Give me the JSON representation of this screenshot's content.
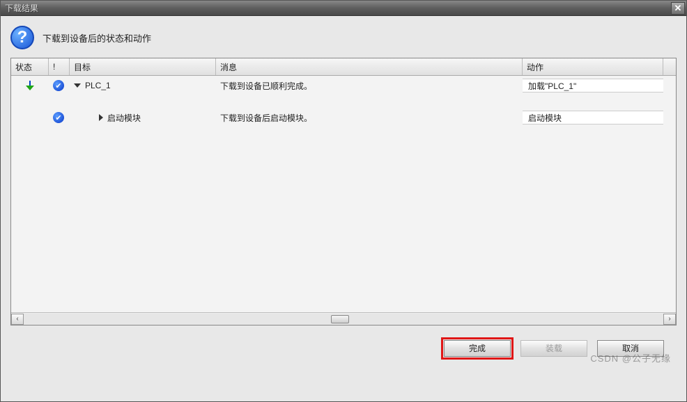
{
  "window": {
    "title": "下载结果"
  },
  "header": {
    "text": "下载到设备后的状态和动作"
  },
  "table": {
    "columns": {
      "status": "状态",
      "exc": "!",
      "target": "目标",
      "msg": "消息",
      "action": "动作"
    },
    "rows": [
      {
        "level": 1,
        "target": "PLC_1",
        "msg": "下载到设备已顺利完成。",
        "action": "加载\"PLC_1\""
      },
      {
        "level": 2,
        "target": "启动模块",
        "msg": "下载到设备后启动模块。",
        "action": "启动模块"
      }
    ]
  },
  "buttons": {
    "finish": "完成",
    "load": "装载",
    "cancel": "取消"
  },
  "watermark": "CSDN @公子无缘"
}
